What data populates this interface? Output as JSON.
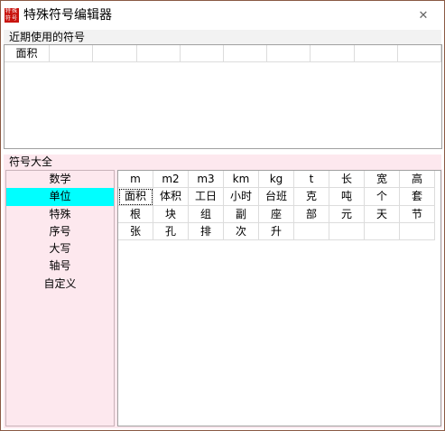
{
  "window": {
    "title": "特殊符号编辑器",
    "app_icon_text": "特殊符号"
  },
  "recent": {
    "label": "近期使用的符号",
    "items": [
      "面积",
      "",
      "",
      "",
      "",
      "",
      "",
      "",
      "",
      ""
    ]
  },
  "all": {
    "label": "符号大全",
    "categories": [
      "数学",
      "单位",
      "特殊",
      "序号",
      "大写",
      "轴号",
      "自定义"
    ],
    "selected_category": "单位",
    "symbols": [
      "m",
      "m2",
      "m3",
      "km",
      "kg",
      "t",
      "长",
      "宽",
      "高",
      "面积",
      "体积",
      "工日",
      "小时",
      "台班",
      "克",
      "吨",
      "个",
      "套",
      "根",
      "块",
      "组",
      "副",
      "座",
      "部",
      "元",
      "天",
      "节",
      "张",
      "孔",
      "排",
      "次",
      "升",
      "",
      "",
      "",
      ""
    ],
    "focused_symbol": "面积"
  },
  "colors": {
    "selected_bg": "#00ffff",
    "panel_bg": "#fde8ee",
    "icon_red": "#c9140e"
  }
}
